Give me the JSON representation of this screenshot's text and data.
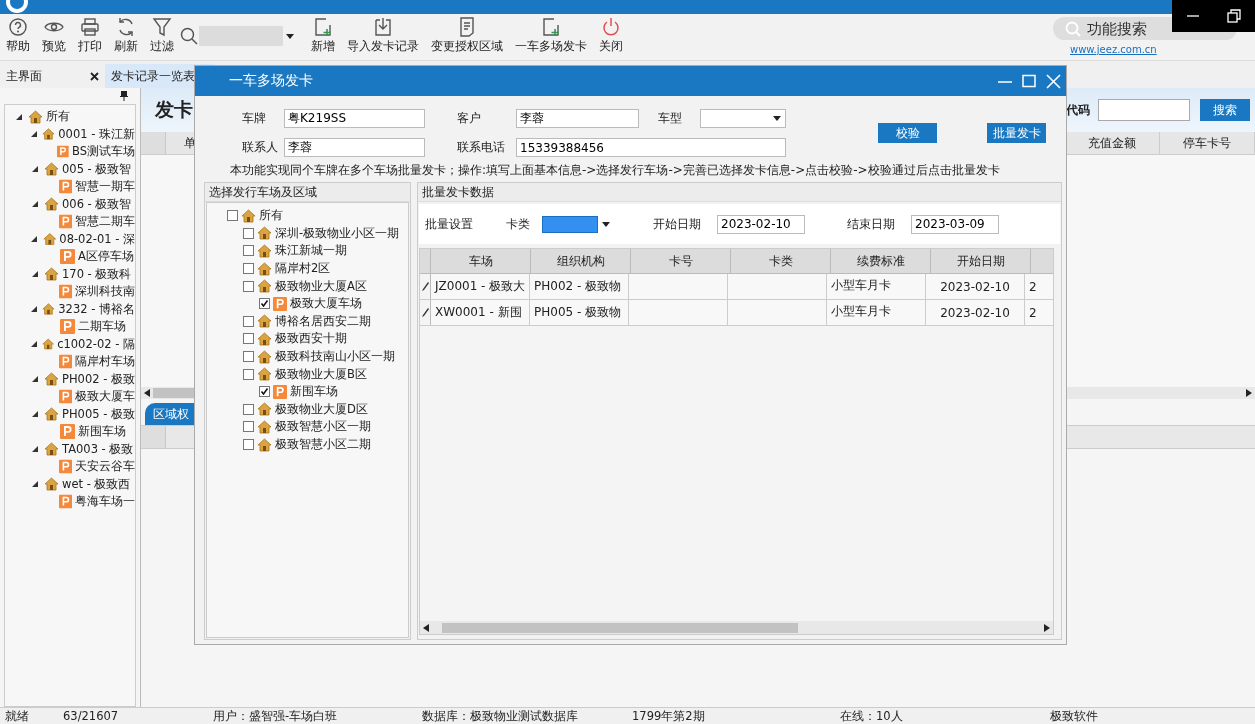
{
  "toolbar": {
    "left": [
      {
        "kind": "help",
        "label": "帮助"
      },
      {
        "kind": "preview",
        "label": "预览"
      },
      {
        "kind": "print",
        "label": "打印"
      },
      {
        "kind": "refresh",
        "label": "刷新"
      },
      {
        "kind": "filter",
        "label": "过滤"
      }
    ],
    "right": [
      {
        "kind": "add",
        "label": "新增"
      },
      {
        "kind": "import",
        "label": "导入发卡记录"
      },
      {
        "kind": "document",
        "label": "变更授权区域"
      },
      {
        "kind": "add",
        "label": "一车多场发卡"
      },
      {
        "kind": "power",
        "label": "关闭"
      }
    ],
    "function_search": {
      "placeholder": "功能搜索"
    },
    "link": "www.jeez.com.cn"
  },
  "tabs": [
    {
      "label": "主界面",
      "closable": true,
      "selected": false
    },
    {
      "label": "发卡记录一览表",
      "closable": false,
      "selected": true
    }
  ],
  "sidebar": {
    "tree": [
      {
        "label": "所有",
        "kind": "area",
        "expanded": true,
        "children": [
          {
            "label": "0001 - 珠江新",
            "kind": "area",
            "expanded": true,
            "children": [
              {
                "label": "BS测试车场",
                "kind": "lot"
              }
            ]
          },
          {
            "label": "005 - 极致智",
            "kind": "area",
            "expanded": true,
            "children": [
              {
                "label": "智慧一期车",
                "kind": "lot"
              }
            ]
          },
          {
            "label": "006 - 极致智",
            "kind": "area",
            "expanded": true,
            "children": [
              {
                "label": "智慧二期车",
                "kind": "lot"
              }
            ]
          },
          {
            "label": "08-02-01 - 深",
            "kind": "area",
            "expanded": true,
            "children": [
              {
                "label": "A区停车场",
                "kind": "lot"
              }
            ]
          },
          {
            "label": "170 - 极致科",
            "kind": "area",
            "expanded": true,
            "children": [
              {
                "label": "深圳科技南",
                "kind": "lot"
              }
            ]
          },
          {
            "label": "3232 - 博裕名",
            "kind": "area",
            "expanded": true,
            "children": [
              {
                "label": "二期车场",
                "kind": "lot"
              }
            ]
          },
          {
            "label": "c1002-02 - 隔",
            "kind": "area",
            "expanded": true,
            "children": [
              {
                "label": "隔岸村车场",
                "kind": "lot"
              }
            ]
          },
          {
            "label": "PH002 - 极致",
            "kind": "area",
            "expanded": true,
            "children": [
              {
                "label": "极致大厦车",
                "kind": "lot"
              }
            ]
          },
          {
            "label": "PH005 - 极致",
            "kind": "area",
            "expanded": true,
            "children": [
              {
                "label": "新围车场",
                "kind": "lot"
              }
            ]
          },
          {
            "label": "TA003 - 极致",
            "kind": "area",
            "expanded": true,
            "children": [
              {
                "label": "天安云谷车",
                "kind": "lot"
              }
            ]
          },
          {
            "label": "wet - 极致西",
            "kind": "area",
            "expanded": true,
            "children": [
              {
                "label": "粤海车场一",
                "kind": "lot"
              }
            ]
          }
        ]
      }
    ]
  },
  "main_view": {
    "heading": "发卡",
    "code_label": "代码",
    "search_button": "搜索",
    "table": {
      "columns": [
        "单",
        "充值金额",
        "停车卡号"
      ]
    },
    "bottom_tabs": [
      {
        "label": "区域权",
        "selected": true
      }
    ]
  },
  "dialog": {
    "title": "一车多场发卡",
    "plate": {
      "label": "车牌",
      "value": "粤K219SS"
    },
    "customer": {
      "label": "客户",
      "value": "李蓉"
    },
    "vehicle_type": {
      "label": "车型"
    },
    "contact": {
      "label": "联系人",
      "value": "李蓉"
    },
    "phone": {
      "label": "联系电话",
      "value": "15339388456"
    },
    "buttons": [
      "校验",
      "批量发卡"
    ],
    "note": "本功能实现同个车牌在多个车场批量发卡；操作:填写上面基本信息->选择发行车场->完善已选择发卡信息->点击校验->校验通过后点击批量发卡",
    "left_panel": {
      "title": "选择发行车场及区域",
      "tree": [
        {
          "label": "所有",
          "kind": "area",
          "checked": false,
          "children": [
            {
              "label": "深圳-极致物业小区一期",
              "kind": "area",
              "checked": false
            },
            {
              "label": "珠江新城一期",
              "kind": "area",
              "checked": false
            },
            {
              "label": "隔岸村2区",
              "kind": "area",
              "checked": false
            },
            {
              "label": "极致物业大厦A区",
              "kind": "area",
              "checked": false,
              "children": [
                {
                  "label": "极致大厦车场",
                  "kind": "lot",
                  "checked": true
                }
              ]
            },
            {
              "label": "博裕名居西安二期",
              "kind": "area",
              "checked": false
            },
            {
              "label": "极致西安十期",
              "kind": "area",
              "checked": false
            },
            {
              "label": "极致科技南山小区一期",
              "kind": "area",
              "checked": false
            },
            {
              "label": "极致物业大厦B区",
              "kind": "area",
              "checked": false,
              "children": [
                {
                  "label": "新围车场",
                  "kind": "lot",
                  "checked": true
                }
              ]
            },
            {
              "label": "极致物业大厦D区",
              "kind": "area",
              "checked": false
            },
            {
              "label": "极致智慧小区一期",
              "kind": "area",
              "checked": false
            },
            {
              "label": "极致智慧小区二期",
              "kind": "area",
              "checked": false
            }
          ]
        }
      ]
    },
    "right_panel": {
      "title": "批量发卡数据",
      "settings": {
        "label": "批量设置",
        "card_type": {
          "label": "卡类",
          "focused": true
        },
        "start_date": {
          "label": "开始日期",
          "value": "2023-02-10"
        },
        "end_date": {
          "label": "结束日期",
          "value": "2023-03-09"
        }
      },
      "grid": {
        "columns": [
          "车场",
          "组织机构",
          "卡号",
          "卡类",
          "续费标准",
          "开始日期"
        ],
        "rows": [
          {
            "lot": "JZ0001 - 极致大",
            "org": "PH002 - 极致物",
            "fee_standard": "小型车月卡",
            "start_date": "2023-02-10",
            "column_7": "2"
          },
          {
            "lot": "XW0001 - 新围",
            "org": "PH005 - 极致物",
            "fee_standard": "小型车月卡",
            "start_date": "2023-02-10",
            "column_7": "2"
          }
        ]
      }
    }
  },
  "status_bar": [
    "就绪",
    "63/21607",
    "用户：盛智强-车场白班",
    "数据库：极致物业测试数据库",
    "1799年第2期",
    "在线：10人",
    "极致软件"
  ]
}
